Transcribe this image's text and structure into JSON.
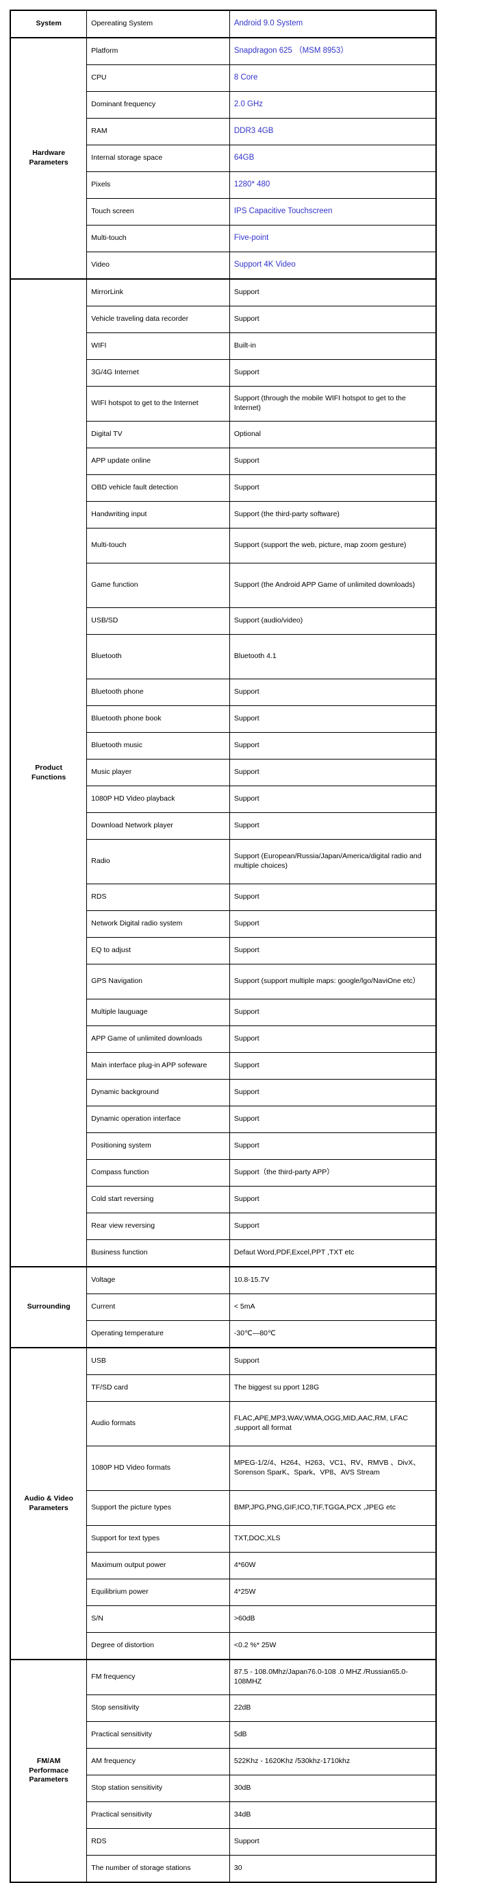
{
  "document": {
    "title": "Product Specification Table",
    "accent_color": "#3333cc",
    "text_color": "#000000",
    "border_color": "#000000",
    "background": "#ffffff"
  },
  "sections": [
    {
      "group": "System",
      "rows": [
        {
          "item": "Opereating System",
          "value": "Android 9.0 System",
          "accent": true,
          "lines": 1
        }
      ]
    },
    {
      "group": "Hardware\nParameters",
      "group_lines": [
        "Hardware",
        "Parameters"
      ],
      "rows": [
        {
          "item": "Platform",
          "value": "Snapdragon 625 （MSM 8953）",
          "accent": true,
          "lines": 1
        },
        {
          "item": "CPU",
          "value": "8 Core",
          "accent": true,
          "lines": 1
        },
        {
          "item": "Dominant frequency",
          "value": "2.0 GHz",
          "accent": true,
          "lines": 1
        },
        {
          "item": "RAM",
          "value": "DDR3  4GB",
          "accent": true,
          "lines": 1
        },
        {
          "item": "Internal storage space",
          "value": "64GB",
          "accent": true,
          "lines": 1
        },
        {
          "item": "Pixels",
          "value": "1280* 480",
          "accent": true,
          "lines": 1
        },
        {
          "item": "Touch screen",
          "value": "IPS Capacitive Touchscreen",
          "accent": true,
          "lines": 1
        },
        {
          "item": "Multi-touch",
          "value": "Five-point",
          "accent": true,
          "lines": 1
        },
        {
          "item": "Video",
          "value": "Support 4K Video",
          "accent": true,
          "lines": 1
        }
      ]
    },
    {
      "group": "Product\nFunctions",
      "group_lines": [
        "Product",
        "Functions"
      ],
      "rows": [
        {
          "item": "MirrorLink",
          "value": "Support",
          "accent": false,
          "lines": 1
        },
        {
          "item": "Vehicle traveling data recorder",
          "value": "Support",
          "accent": false,
          "lines": 1
        },
        {
          "item": "WIFI",
          "value": "Built-in",
          "accent": false,
          "lines": 1
        },
        {
          "item": "3G/4G  Internet",
          "value": "Support",
          "accent": false,
          "lines": 1
        },
        {
          "item": "WIFI hotspot to get to the Internet",
          "value": "Support (through the mobile WIFI hotspot to get to the Internet)",
          "accent": false,
          "lines": 2
        },
        {
          "item": "Digital TV",
          "value": "Optional",
          "accent": false,
          "lines": 1
        },
        {
          "item": "APP update online",
          "value": "Support",
          "accent": false,
          "lines": 1
        },
        {
          "item": "OBD vehicle fault detection",
          "value": "Support",
          "accent": false,
          "lines": 1
        },
        {
          "item": "Handwriting input",
          "value": "Support (the third-party software)",
          "accent": false,
          "lines": 1
        },
        {
          "item": "Multi-touch",
          "value": "Support (support the web, picture, map zoom gesture)",
          "accent": false,
          "lines": 2
        },
        {
          "item": "Game function",
          "value": "Support (the Android APP Game of unlimited downloads)",
          "accent": false,
          "lines": 3
        },
        {
          "item": "USB/SD",
          "value": "Support (audio/video)",
          "accent": false,
          "lines": 1
        },
        {
          "item": "Bluetooth",
          "value": "Bluetooth 4.1",
          "accent": false,
          "lines": 3
        },
        {
          "item": "Bluetooth phone",
          "value": "Support",
          "accent": false,
          "lines": 1
        },
        {
          "item": "Bluetooth phone book",
          "value": "Support",
          "accent": false,
          "lines": 1
        },
        {
          "item": "Bluetooth music",
          "value": "Support",
          "accent": false,
          "lines": 1
        },
        {
          "item": "Music player",
          "value": "Support",
          "accent": false,
          "lines": 1
        },
        {
          "item": "1080P HD Video playback",
          "value": "Support",
          "accent": false,
          "lines": 1
        },
        {
          "item": "Download Network player",
          "value": "Support",
          "accent": false,
          "lines": 1
        },
        {
          "item": "Radio",
          "value": "Support (European/Russia/Japan/America/digital radio and multiple choices)",
          "accent": false,
          "lines": 3
        },
        {
          "item": "RDS",
          "value": "Support",
          "accent": false,
          "lines": 1
        },
        {
          "item": "Network Digital radio system",
          "value": "Support",
          "accent": false,
          "lines": 1
        },
        {
          "item": "EQ to adjust",
          "value": "Support",
          "accent": false,
          "lines": 1
        },
        {
          "item": "GPS Navigation",
          "value": "Support (support multiple maps: google/lgo/NaviOne etc）",
          "accent": false,
          "lines": 2
        },
        {
          "item": "Multiple lauguage",
          "value": "Support",
          "accent": false,
          "lines": 1
        },
        {
          "item": "APP Game of unlimited downloads",
          "value": "Support",
          "accent": false,
          "lines": 1
        },
        {
          "item": "Main interface plug-in APP sofeware",
          "value": "Support",
          "accent": false,
          "lines": 1
        },
        {
          "item": "Dynamic background",
          "value": "Support",
          "accent": false,
          "lines": 1
        },
        {
          "item": "Dynamic operation interface",
          "value": "Support",
          "accent": false,
          "lines": 1
        },
        {
          "item": "Positioning system",
          "value": "Support",
          "accent": false,
          "lines": 1
        },
        {
          "item": "Compass function",
          "value": "Support（the third-party APP）",
          "accent": false,
          "lines": 1
        },
        {
          "item": "Cold start reversing",
          "value": "Support",
          "accent": false,
          "lines": 1
        },
        {
          "item": "Rear view reversing",
          "value": "Support",
          "accent": false,
          "lines": 1
        },
        {
          "item": "Business function",
          "value": "Defaut Word,PDF,Excel,PPT ,TXT etc",
          "accent": false,
          "lines": 1
        }
      ]
    },
    {
      "group": "Surrounding",
      "group_lines": [
        "Surrounding"
      ],
      "rows": [
        {
          "item": "Voltage",
          "value": "10.8-15.7V",
          "accent": false,
          "lines": 1
        },
        {
          "item": "Current",
          "value": "< 5mA",
          "accent": false,
          "lines": 1
        },
        {
          "item": "Operating temperature",
          "value": "-30℃—80℃",
          "accent": false,
          "lines": 1
        }
      ]
    },
    {
      "group": "Audio & Video\nParameters",
      "group_lines": [
        "Audio & Video",
        "Parameters"
      ],
      "rows": [
        {
          "item": "USB",
          "value": "Support",
          "accent": false,
          "lines": 1
        },
        {
          "item": "TF/SD card",
          "value": "The biggest su pport 128G",
          "accent": false,
          "lines": 1
        },
        {
          "item": "Audio formats",
          "value": "FLAC,APE,MP3,WAV,WMA,OGG,MID,AAC,RM, LFAC ,support all format",
          "accent": false,
          "lines": 3
        },
        {
          "item": "1080P HD Video formats",
          "value": "MPEG-1/2/4、H264、H263、VC1、RV、RMVB 、DivX、Sorenson SparK、Spark、VP8、AVS Stream",
          "accent": false,
          "lines": 3
        },
        {
          "item": "Support the picture types",
          "value": "BMP,JPG,PNG,GIF,ICO,TIF,TGGA,PCX ,JPEG etc",
          "accent": false,
          "lines": 2
        },
        {
          "item": "Support for text types",
          "value": "TXT,DOC,XLS",
          "accent": false,
          "lines": 1
        },
        {
          "item": "Maximum output power",
          "value": "4*60W",
          "accent": false,
          "lines": 1
        },
        {
          "item": "Equilibrium power",
          "value": "4*25W",
          "accent": false,
          "lines": 1
        },
        {
          "item": "S/N",
          "value": ">60dB",
          "accent": false,
          "lines": 1
        },
        {
          "item": "Degree of distortion",
          "value": "<0.2 %* 25W",
          "accent": false,
          "lines": 1
        }
      ]
    },
    {
      "group": "FM/AM\nPerformace\nParameters",
      "group_lines": [
        "FM/AM",
        "Performace",
        "Parameters"
      ],
      "rows": [
        {
          "item": "FM frequency",
          "value": "87.5 - 108.0Mhz/Japan76.0-108 .0 MHZ /Russian65.0-108MHZ",
          "accent": false,
          "lines": 2
        },
        {
          "item": "Stop sensitivity",
          "value": "22dB",
          "accent": false,
          "lines": 1
        },
        {
          "item": "Practical sensitivity",
          "value": "5dB",
          "accent": false,
          "lines": 1
        },
        {
          "item": "AM frequency",
          "value": "522Khz - 1620Khz /530khz-1710khz",
          "accent": false,
          "lines": 1
        },
        {
          "item": "Stop station sensitivity",
          "value": "30dB",
          "accent": false,
          "lines": 1
        },
        {
          "item": "Practical sensitivity",
          "value": "34dB",
          "accent": false,
          "lines": 1
        },
        {
          "item": "RDS",
          "value": "Support",
          "accent": false,
          "lines": 1
        },
        {
          "item": "The number of storage stations",
          "value": "30",
          "accent": false,
          "lines": 1
        }
      ]
    }
  ]
}
